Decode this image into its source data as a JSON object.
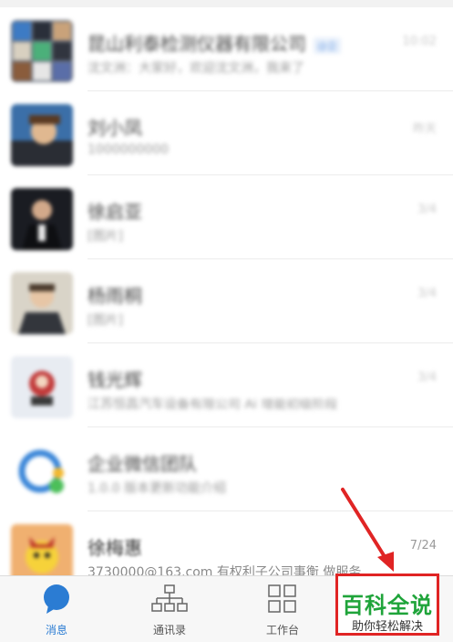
{
  "conversations": [
    {
      "title": "昆山利泰检测仪器有限公司",
      "tag": "@企",
      "subtitle": "沈文洲：大家好，欢迎沈文洲，我来了",
      "time": "10:02"
    },
    {
      "title": "刘小凤",
      "tag": "",
      "subtitle": "1000000000",
      "time": "昨天"
    },
    {
      "title": "徐启亚",
      "tag": "",
      "subtitle": "[图片]",
      "time": "3/4"
    },
    {
      "title": "杨雨桐",
      "tag": "",
      "subtitle": "[图片]",
      "time": "3/4"
    },
    {
      "title": "钱光辉",
      "tag": "",
      "subtitle": "江苏恒昌汽车设备有限公司 Ai 增能初级阶段",
      "time": "3/4"
    },
    {
      "title": "企业微信团队",
      "tag": "",
      "subtitle": "1.0.0 版本更新功能介绍",
      "time": ""
    },
    {
      "title": "徐梅惠",
      "tag": "",
      "subtitle": "3730000@163.com 有权利子公司事衡 做服务...",
      "time": "7/24"
    }
  ],
  "tabbar": {
    "tabs": [
      {
        "label": "消息",
        "icon": "chat-bubble-icon"
      },
      {
        "label": "通讯录",
        "icon": "org-chart-icon"
      },
      {
        "label": "工作台",
        "icon": "grid-icon"
      }
    ]
  },
  "watermark": {
    "main": "百科全说",
    "sub": "助你轻松解决"
  },
  "colors": {
    "accent": "#2b7cd3",
    "arrow": "#e02424",
    "watermark_green": "#1fa43a"
  }
}
